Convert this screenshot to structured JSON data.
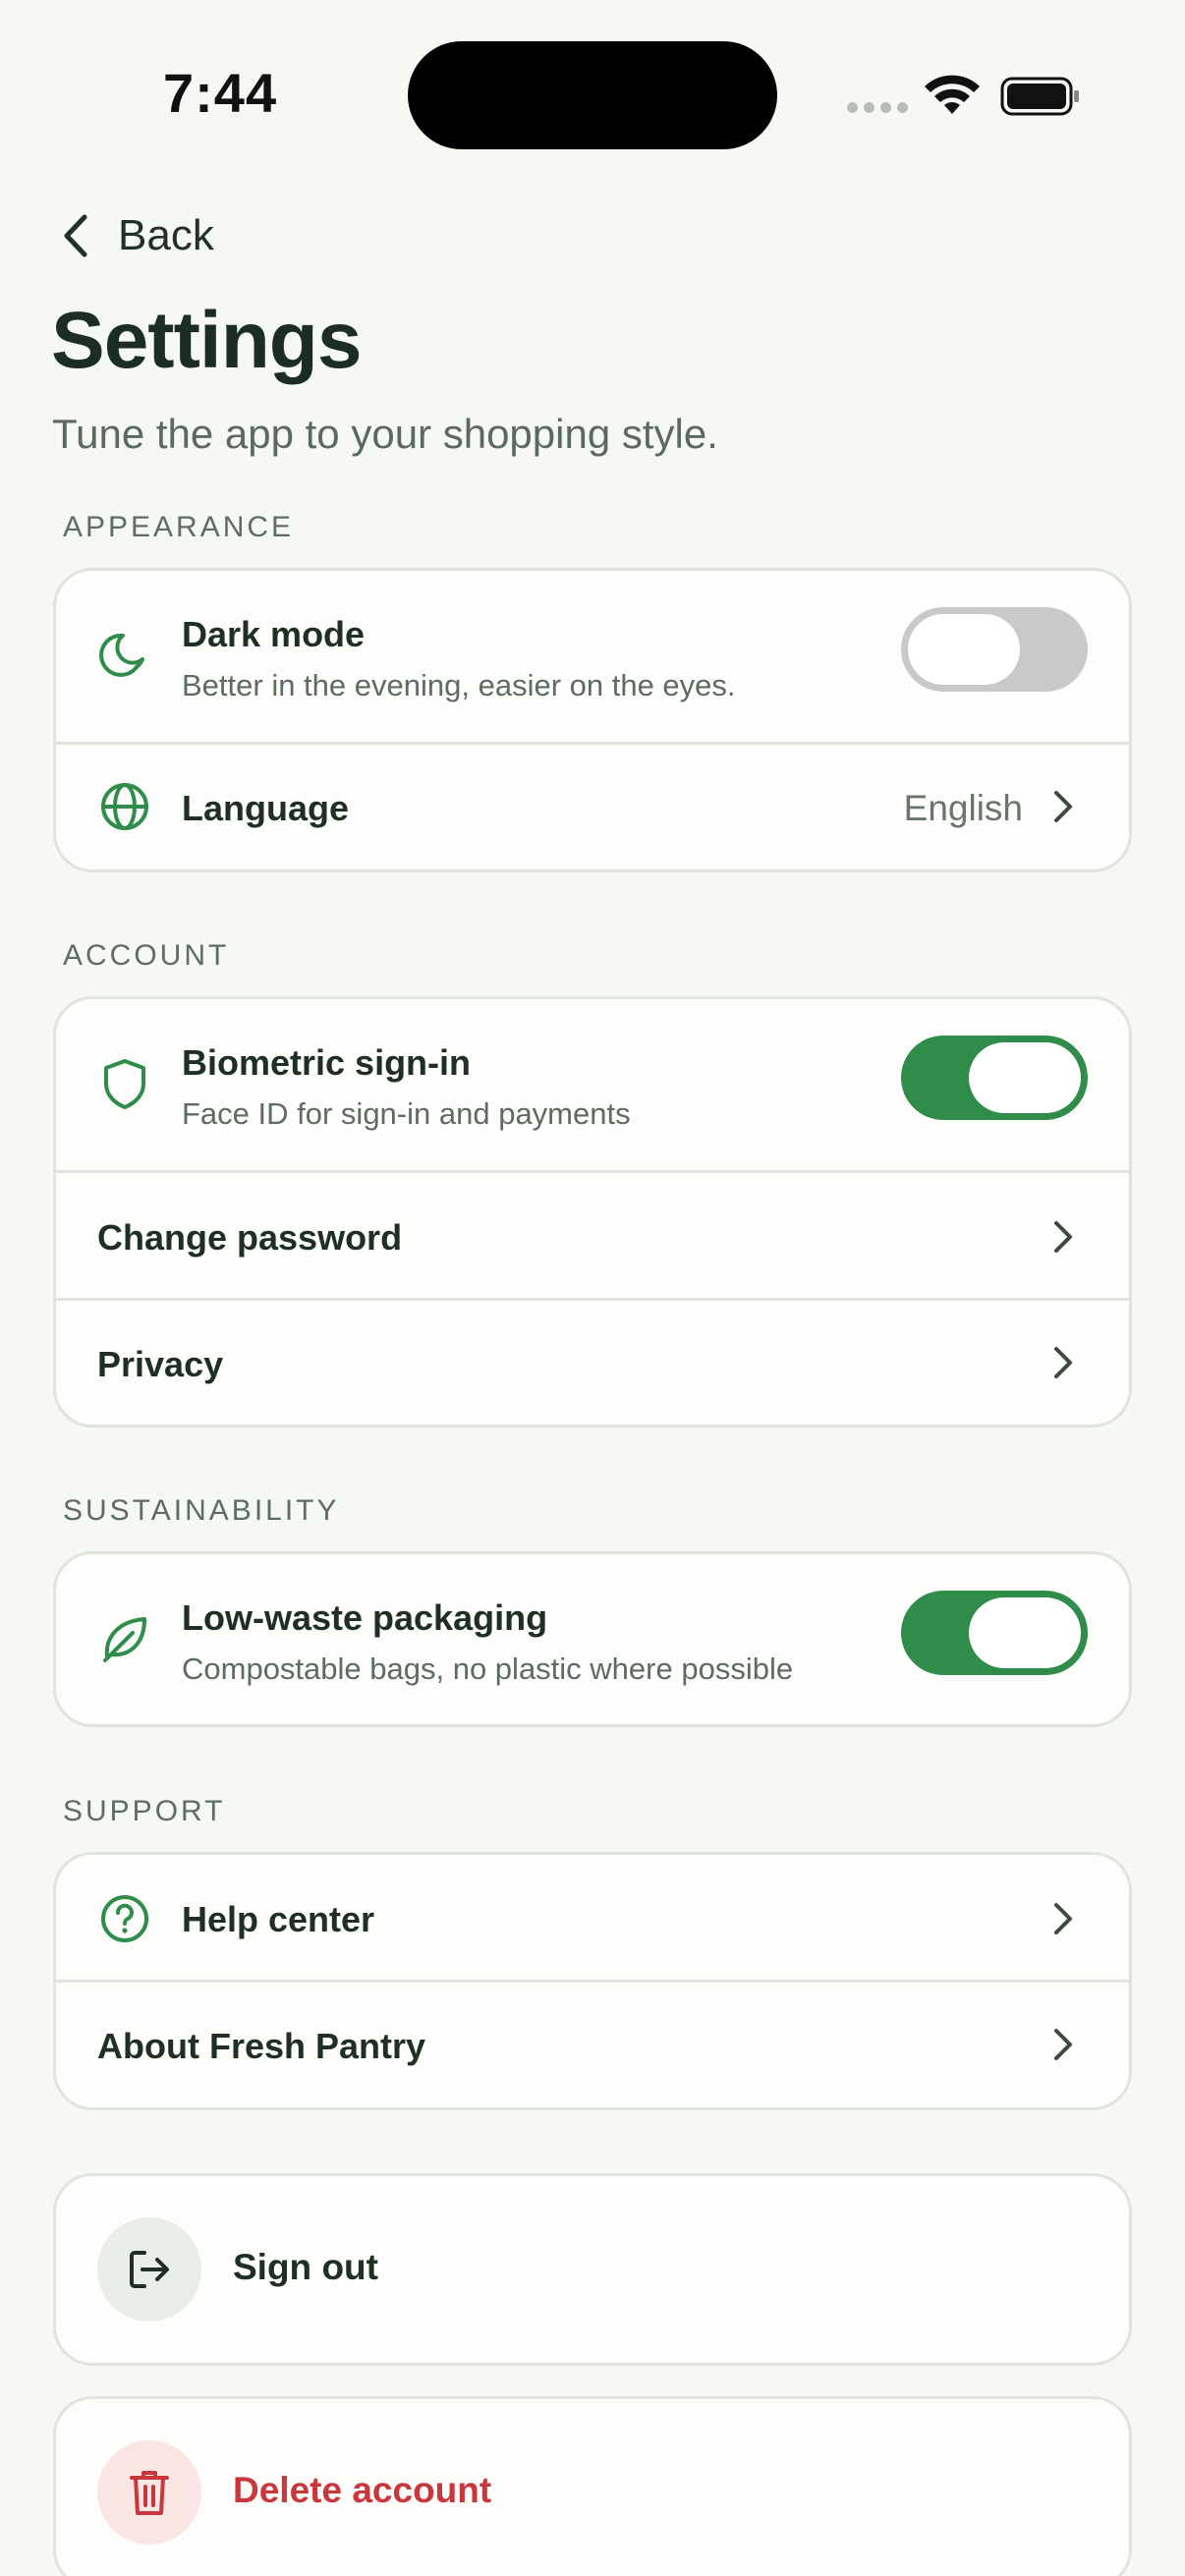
{
  "status_bar": {
    "time": "7:44"
  },
  "header": {
    "back_label": "Back",
    "title": "Settings",
    "subtitle": "Tune the app to your shopping style."
  },
  "sections": {
    "appearance": {
      "label": "APPEARANCE",
      "dark_mode": {
        "title": "Dark mode",
        "subtitle": "Better in the evening, easier on the eyes.",
        "enabled": false,
        "icon": "moon-icon"
      },
      "language": {
        "title": "Language",
        "value": "English",
        "icon": "globe-icon"
      }
    },
    "account": {
      "label": "ACCOUNT",
      "biometric": {
        "title": "Biometric sign-in",
        "subtitle": "Face ID for sign-in and payments",
        "enabled": true,
        "icon": "shield-icon"
      },
      "change_password": {
        "title": "Change password"
      },
      "privacy": {
        "title": "Privacy"
      }
    },
    "sustainability": {
      "label": "SUSTAINABILITY",
      "low_waste": {
        "title": "Low-waste packaging",
        "subtitle": "Compostable bags, no plastic where possible",
        "enabled": true,
        "icon": "leaf-icon"
      }
    },
    "support": {
      "label": "SUPPORT",
      "help_center": {
        "title": "Help center",
        "icon": "help-circle-icon"
      },
      "about": {
        "title": "About Fresh Pantry"
      }
    }
  },
  "actions": {
    "sign_out": {
      "label": "Sign out",
      "icon": "sign-out-icon"
    },
    "delete_account": {
      "label": "Delete account",
      "icon": "trash-icon"
    }
  },
  "colors": {
    "accent": "#2f8c4a",
    "danger": "#c8373b",
    "background": "#f6f8f4"
  }
}
